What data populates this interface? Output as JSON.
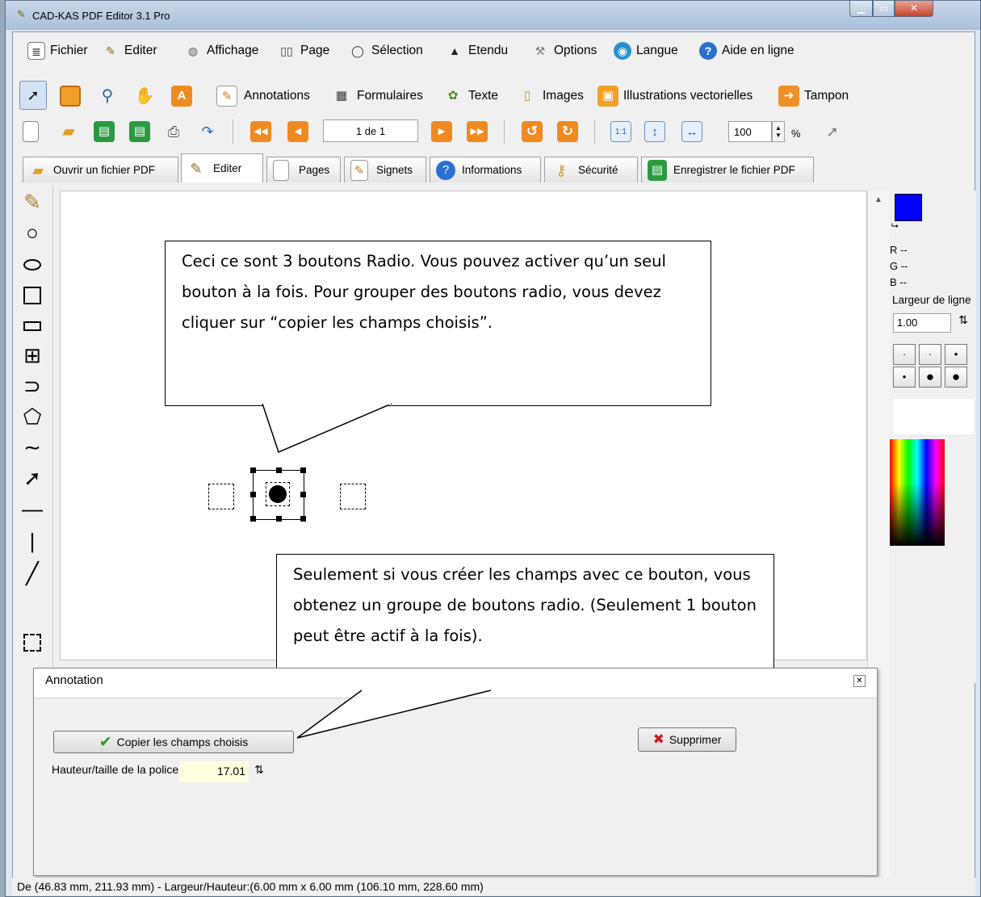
{
  "window": {
    "title": "CAD-KAS PDF Editor 3.1 Pro",
    "minimize_icon": "minimize-icon",
    "maximize_icon": "maximize-icon",
    "close_icon": "close-icon"
  },
  "menu": [
    {
      "label": "Fichier",
      "icon": "document-icon"
    },
    {
      "label": "Editer",
      "icon": "pen-icon"
    },
    {
      "label": "Affichage",
      "icon": "view-icon"
    },
    {
      "label": "Page",
      "icon": "book-icon"
    },
    {
      "label": "Sélection",
      "icon": "lasso-icon"
    },
    {
      "label": "Etendu",
      "icon": "graduation-cap-icon"
    },
    {
      "label": "Options",
      "icon": "wrench-icon"
    },
    {
      "label": "Langue",
      "icon": "globe-icon"
    },
    {
      "label": "Aide en ligne",
      "icon": "help-icon"
    }
  ],
  "toolbar1": [
    {
      "label": "Annotations",
      "icon": "annotation-icon"
    },
    {
      "label": "Formulaires",
      "icon": "form-icon"
    },
    {
      "label": "Texte",
      "icon": "text-icon"
    },
    {
      "label": "Images",
      "icon": "image-icon"
    },
    {
      "label": "Illustrations vectorielles",
      "icon": "vector-icon"
    },
    {
      "label": "Tampon",
      "icon": "stamp-icon"
    }
  ],
  "toolbar2": {
    "page_field": "1 de 1",
    "zoom_value": "100",
    "zoom_unit": "%",
    "fit_label": "1:1"
  },
  "tabs": [
    {
      "label": "Ouvrir un fichier PDF",
      "icon": "open-folder-icon"
    },
    {
      "label": "Editer",
      "icon": "pen-icon",
      "active": true
    },
    {
      "label": "Pages",
      "icon": "pages-icon"
    },
    {
      "label": "Signets",
      "icon": "bookmark-icon"
    },
    {
      "label": "Informations",
      "icon": "info-icon"
    },
    {
      "label": "Sécurité",
      "icon": "key-icon"
    },
    {
      "label": "Enregistrer le fichier PDF",
      "icon": "save-icon"
    }
  ],
  "callouts": {
    "top": "Ceci ce sont 3 boutons Radio. Vous pouvez activer qu’un seul bouton à la fois. Pour grouper des boutons radio, vous devez cliquer sur “copier les champs choisis”.",
    "bottom": "Seulement si vous créer les champs avec ce bouton, vous obtenez un groupe de boutons radio. (Seulement 1 bouton peut être actif à la fois)."
  },
  "right_panel": {
    "primary_color": "#0000ff",
    "secondary_color": "#ffff00",
    "r_label": "R --",
    "g_label": "G --",
    "b_label": "B --",
    "line_width_label": "Largeur de ligne",
    "line_width_value": "1.00"
  },
  "dialog": {
    "title": "Annotation",
    "copy_button": "Copier les champs choisis",
    "delete_button": "Supprimer",
    "font_size_label": "Hauteur/taille de la police",
    "font_size_value": "17.01"
  },
  "status": {
    "text": "De (46.83 mm, 211.93 mm) - Largeur/Hauteur:(6.00 mm x 6.00 mm (106.10 mm, 228.60 mm)"
  }
}
